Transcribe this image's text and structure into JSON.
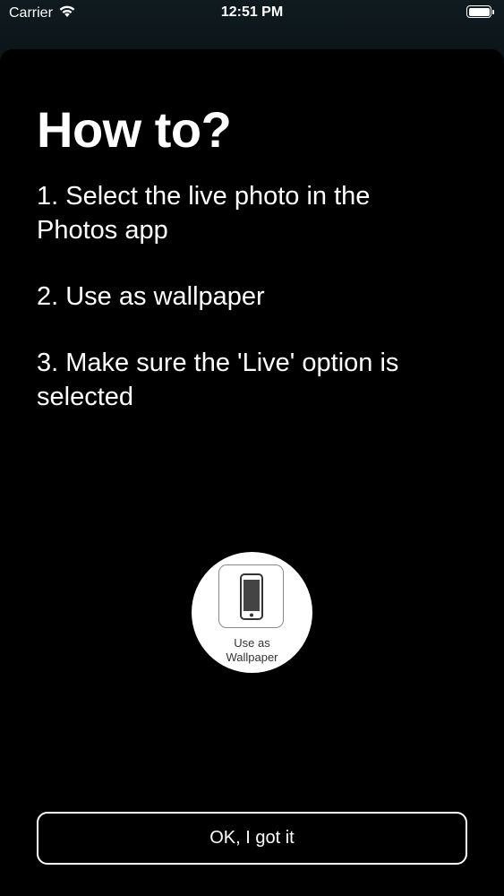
{
  "status_bar": {
    "carrier": "Carrier",
    "time": "12:51 PM",
    "wifi_icon": "wifi-icon",
    "battery_icon": "battery-icon",
    "battery_level": 1.0
  },
  "sheet": {
    "title": "How to?",
    "steps": [
      "1. Select the live photo in the Photos app",
      "2. Use as wallpaper",
      "3. Make sure the 'Live' option is selected"
    ],
    "wallpaper_hint": {
      "icon": "phone-icon",
      "label_line1": "Use as",
      "label_line2": "Wallpaper"
    },
    "ok_button_label": "OK, I got it"
  },
  "colors": {
    "background": "#000000",
    "text": "#ffffff",
    "button_border": "#ffffff"
  }
}
